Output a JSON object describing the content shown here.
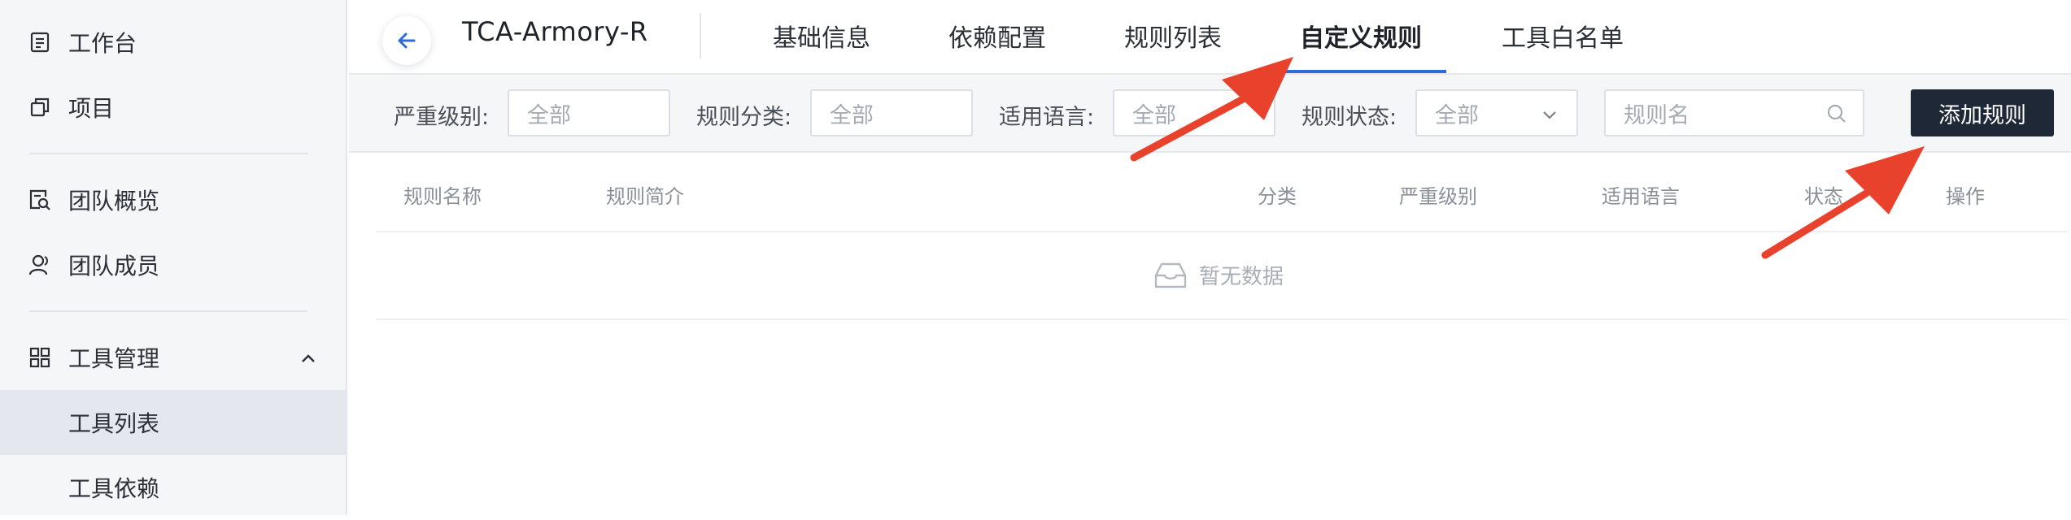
{
  "sidebar": {
    "items": [
      {
        "label": "工作台",
        "icon": "document-icon"
      },
      {
        "label": "项目",
        "icon": "copy-icon"
      },
      {
        "label": "团队概览",
        "icon": "search-doc-icon"
      },
      {
        "label": "团队成员",
        "icon": "user-icon"
      },
      {
        "label": "工具管理",
        "icon": "grid-icon"
      },
      {
        "label": "工具列表",
        "icon": ""
      },
      {
        "label": "工具依赖",
        "icon": ""
      }
    ]
  },
  "header": {
    "title": "TCA-Armory-R",
    "tabs": [
      {
        "label": "基础信息"
      },
      {
        "label": "依赖配置"
      },
      {
        "label": "规则列表"
      },
      {
        "label": "自定义规则"
      },
      {
        "label": "工具白名单"
      }
    ],
    "accent_color": "#2f6bd8"
  },
  "filters": {
    "severity_label": "严重级别:",
    "severity_value": "全部",
    "category_label": "规则分类:",
    "category_value": "全部",
    "language_label": "适用语言:",
    "language_value": "全部",
    "status_label": "规则状态:",
    "status_value": "全部",
    "search_placeholder": "规则名",
    "add_button": "添加规则"
  },
  "table": {
    "columns": [
      "规则名称",
      "规则简介",
      "分类",
      "严重级别",
      "适用语言",
      "状态",
      "操作"
    ],
    "empty_text": "暂无数据"
  },
  "annotation_color": "#e8412c"
}
